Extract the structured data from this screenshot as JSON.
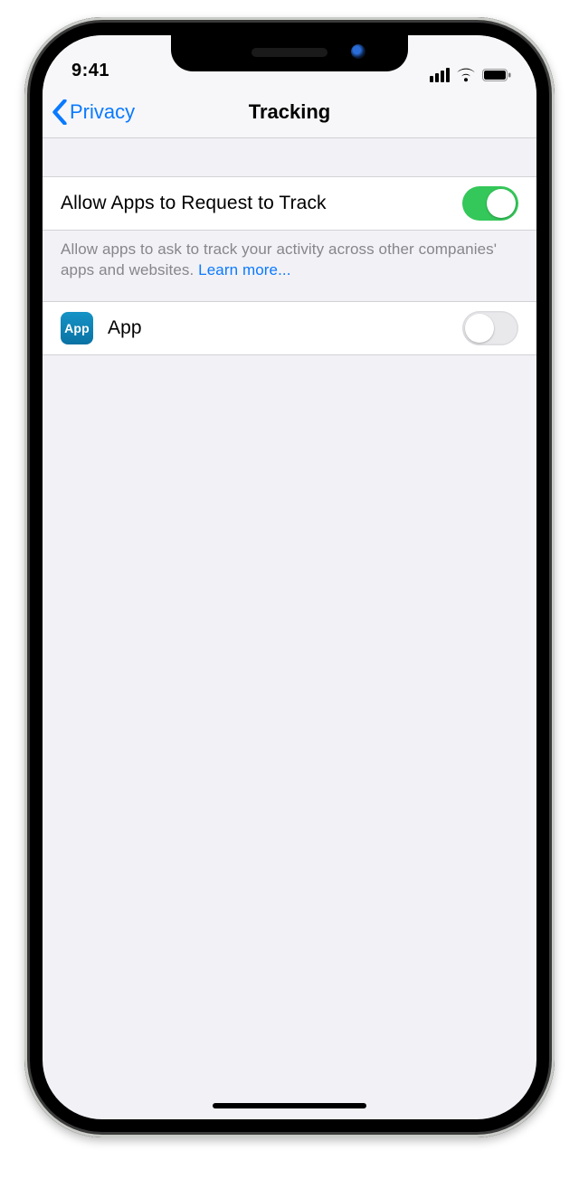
{
  "statusbar": {
    "time": "9:41"
  },
  "nav": {
    "back_label": "Privacy",
    "title": "Tracking"
  },
  "main_toggle": {
    "label": "Allow Apps to Request to Track",
    "on": true,
    "footer_text": "Allow apps to ask to track your activity across other companies' apps and websites. ",
    "learn_more_label": "Learn more..."
  },
  "apps": [
    {
      "icon_text": "App",
      "name": "App",
      "on": false
    }
  ],
  "colors": {
    "link": "#0a7aff",
    "switch_on": "#34c759",
    "bg": "#f2f1f6"
  }
}
